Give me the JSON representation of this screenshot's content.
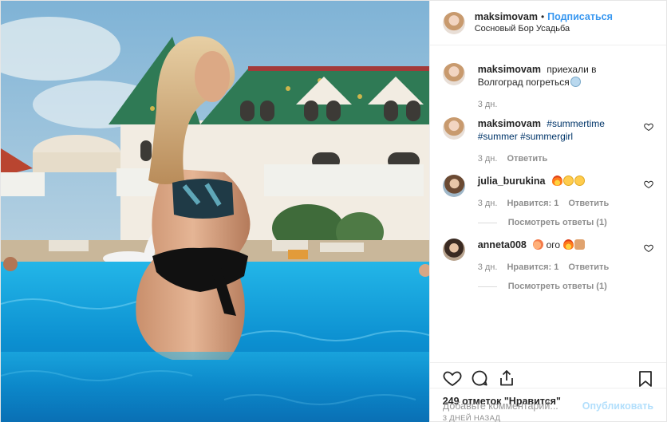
{
  "header": {
    "username": "maksimovam",
    "separator": "•",
    "follow_label": "Подписаться",
    "location": "Сосновый Бор Усадьба"
  },
  "comments": [
    {
      "username": "maksimovam",
      "text": "приехали в Волгоград погреться",
      "emoji": [
        "scream-emoji"
      ],
      "time": "3 дн.",
      "likes": "",
      "reply_label": "",
      "view_replies": "",
      "has_heart": false
    },
    {
      "username": "maksimovam",
      "tags": [
        "#summertime",
        "#summer",
        "#summergirl"
      ],
      "time": "3 дн.",
      "reply_label": "Ответить",
      "has_heart": true
    },
    {
      "username": "julia_burukina",
      "emoji": [
        "fire-emoji",
        "grin-emoji",
        "grin-emoji"
      ],
      "time": "3 дн.",
      "likes": "Нравится: 1",
      "reply_label": "Ответить",
      "view_replies": "Посмотреть ответы (1)",
      "has_heart": true
    },
    {
      "username": "anneta008",
      "text_after_emoji": "ого",
      "emoji_before": [
        "peach-emoji"
      ],
      "emoji_after": [
        "fire-emoji",
        "thumbs-up-emoji"
      ],
      "time": "3 дн.",
      "likes": "Нравится: 1",
      "reply_label": "Ответить",
      "view_replies": "Посмотреть ответы (1)",
      "has_heart": true
    }
  ],
  "actions": {
    "icons": [
      "heart-icon",
      "comment-icon",
      "share-icon",
      "bookmark-icon"
    ]
  },
  "likes_count": "249",
  "likes_text": "отметок \"Нравится\"",
  "posted_ago": "3 ДНЕЙ НАЗАД",
  "add_comment": {
    "placeholder": "Добавьте комментарий...",
    "publish_label": "Опубликовать"
  },
  "colors": {
    "link_blue": "#3897f0",
    "publish_disabled": "#b2dffc",
    "muted_text": "#8e8e8e",
    "tag_color": "#003569"
  }
}
